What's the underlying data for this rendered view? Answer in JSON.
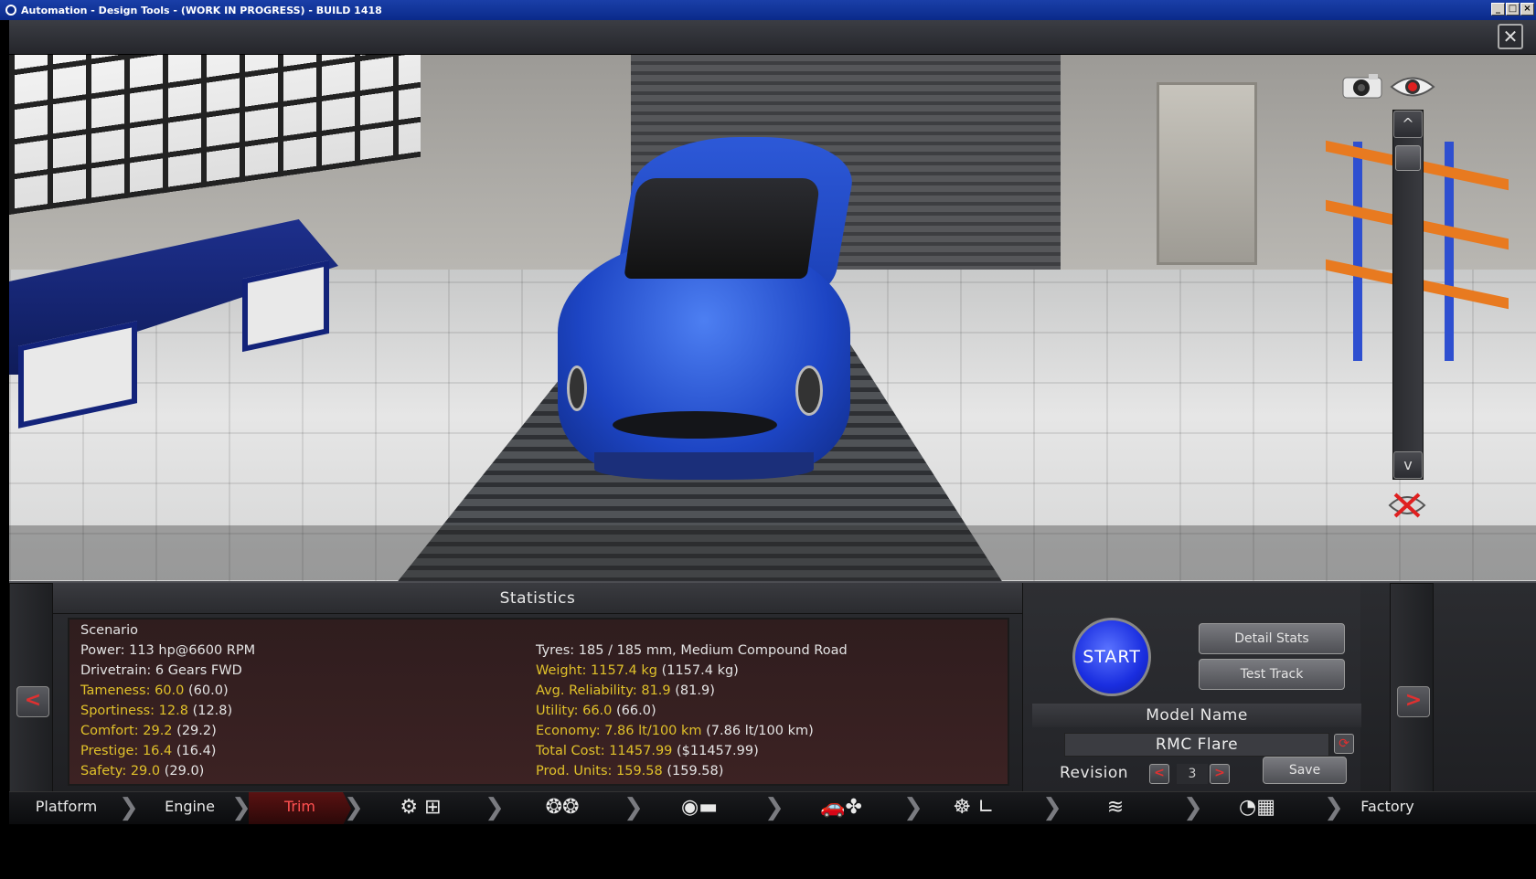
{
  "window": {
    "title": "Automation - Design Tools - (WORK IN PROGRESS) - BUILD 1418",
    "close_glyph": "✕"
  },
  "viewport": {
    "icons": [
      "camera-icon",
      "eye-icon",
      "scroll-up-icon",
      "scroll-down-icon",
      "reset-view-icon"
    ],
    "scroll_up": "^",
    "scroll_down": "v"
  },
  "statistics": {
    "title": "Statistics",
    "left": [
      {
        "label": "Scenario",
        "value": "",
        "paren": "",
        "highlight": false
      },
      {
        "label": "Power: ",
        "value": "113 hp@6600 RPM",
        "paren": "",
        "highlight": false
      },
      {
        "label": "Drivetrain: ",
        "value": "6 Gears FWD",
        "paren": "",
        "highlight": false
      },
      {
        "label": "Tameness: ",
        "value": "60.0",
        "paren": "(60.0)",
        "highlight": true
      },
      {
        "label": "Sportiness: ",
        "value": "12.8",
        "paren": "(12.8)",
        "highlight": true
      },
      {
        "label": "Comfort: ",
        "value": "29.2",
        "paren": "(29.2)",
        "highlight": true
      },
      {
        "label": "Prestige: ",
        "value": "16.4",
        "paren": "(16.4)",
        "highlight": true
      },
      {
        "label": "Safety: ",
        "value": "29.0",
        "paren": "(29.0)",
        "highlight": true
      }
    ],
    "right": [
      {
        "label": "Tyres: ",
        "value": "185 / 185 mm, Medium Compound Road",
        "paren": "",
        "highlight": false
      },
      {
        "label": "Weight: ",
        "value": "1157.4 kg",
        "paren": "(1157.4 kg)",
        "highlight": true
      },
      {
        "label": "Avg. Reliability: ",
        "value": "81.9",
        "paren": "(81.9)",
        "highlight": true
      },
      {
        "label": "Utility: ",
        "value": "66.0",
        "paren": "(66.0)",
        "highlight": true
      },
      {
        "label": "Economy: ",
        "value": "7.86 lt/100 km",
        "paren": "(7.86 lt/100 km)",
        "highlight": true
      },
      {
        "label": "Total Cost: ",
        "value": "11457.99",
        "paren": "($11457.99)",
        "highlight": true
      },
      {
        "label": "Prod. Units: ",
        "value": "159.58",
        "paren": "(159.58)",
        "highlight": true
      }
    ]
  },
  "actions": {
    "start": "START",
    "detail_stats": "Detail Stats",
    "test_track": "Test Track",
    "model_name_label": "Model Name",
    "model_name_value": "RMC Flare",
    "revision_label": "Revision",
    "revision_prev": "<",
    "revision_value": "3",
    "revision_next": ">",
    "save": "Save"
  },
  "nav": {
    "prev": "<",
    "next": ">"
  },
  "tabs": [
    {
      "label": "Platform",
      "active": false
    },
    {
      "label": "Engine",
      "active": false
    },
    {
      "label": "Trim",
      "active": true
    },
    {
      "label": "",
      "icon": "gearbox-icon",
      "active": false
    },
    {
      "label": "",
      "icon": "wheels-icon",
      "active": false
    },
    {
      "label": "",
      "icon": "brakes-body-icon",
      "active": false
    },
    {
      "label": "",
      "icon": "body-aero-icon",
      "active": false
    },
    {
      "label": "",
      "icon": "steering-seat-icon",
      "active": false
    },
    {
      "label": "",
      "icon": "suspension-icon",
      "active": false
    },
    {
      "label": "",
      "icon": "testing-icon",
      "active": false
    },
    {
      "label": "Factory",
      "active": false
    }
  ],
  "colors": {
    "highlight": "#e0c12a",
    "accent_red": "#e03030",
    "start_blue": "#1a2ee0",
    "car_blue": "#1d45c4"
  }
}
